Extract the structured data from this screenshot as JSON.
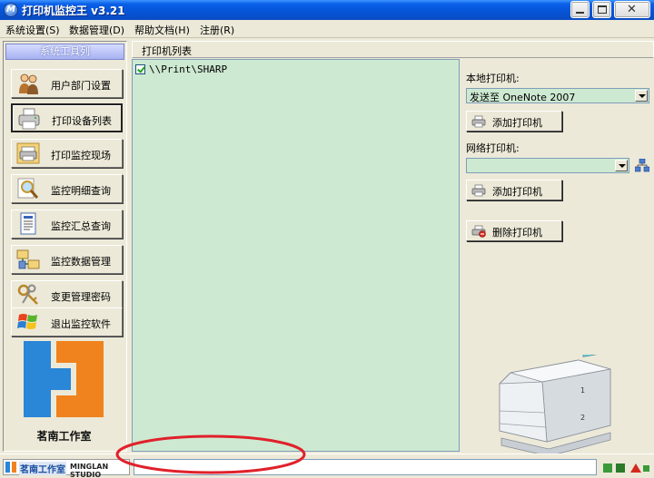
{
  "window": {
    "title": "打印机监控王 v3.21",
    "app_icon_letter": "M",
    "close_glyph": "✕"
  },
  "menu": [
    "系统设置(S)",
    "数据管理(D)",
    "帮助文档(H)",
    "注册(R)"
  ],
  "sidebar": {
    "header": "系统工具列",
    "items": [
      {
        "label": "用户部门设置",
        "icon": "users-icon"
      },
      {
        "label": "打印设备列表",
        "icon": "printer-icon",
        "active": true
      },
      {
        "label": "打印监控现场",
        "icon": "printer-monitor-icon"
      },
      {
        "label": "监控明细查询",
        "icon": "magnifier-icon"
      },
      {
        "label": "监控汇总查询",
        "icon": "report-icon"
      },
      {
        "label": "监控数据管理",
        "icon": "data-manage-icon"
      },
      {
        "label": "变更管理密码",
        "icon": "keys-icon"
      },
      {
        "label": "退出监控软件",
        "icon": "windows-flag-icon"
      }
    ],
    "logo_text": "茗南工作室",
    "logo_colors": [
      "#2A86D6",
      "#F0831E"
    ]
  },
  "printer_list": {
    "header": "打印机列表",
    "rows": [
      {
        "checked": true,
        "name": "\\\\Print\\SHARP"
      }
    ]
  },
  "right_panel": {
    "local_label": "本地打印机:",
    "local_selected": "发送至 OneNote 2007",
    "add_button_1": "添加打印机",
    "network_label": "网络打印机:",
    "network_selected": "",
    "add_button_2": "添加打印机",
    "delete_button": "删除打印机"
  },
  "status_bar": {
    "logo_cn": "茗南工作室",
    "logo_en": "MINGLAN STUDIO",
    "message": ""
  },
  "colors": {
    "titlebar": "#0A5FE8",
    "list_background": "#CDE9D1",
    "panel": "#ECE9D8",
    "annotation": "#E0212B"
  }
}
